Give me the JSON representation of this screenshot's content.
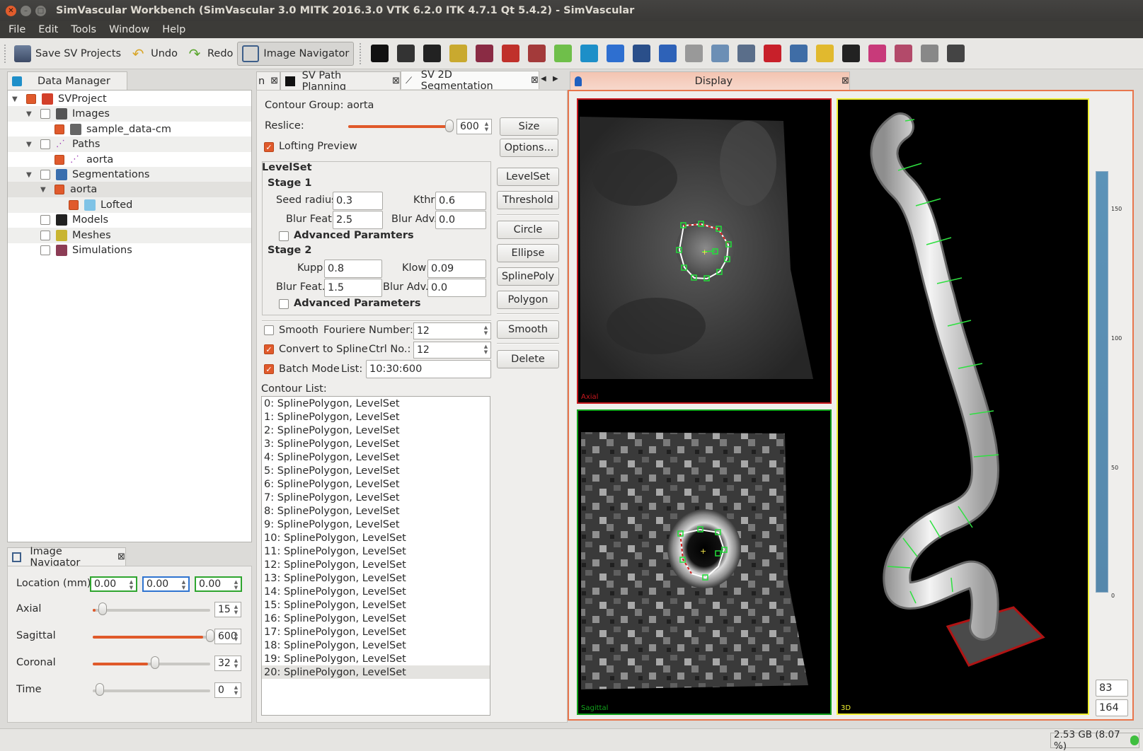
{
  "window": {
    "title": "SimVascular Workbench (SimVascular 3.0 MITK 2016.3.0 VTK 6.2.0 ITK 4.7.1 Qt 5.4.2) - SimVascular"
  },
  "menu": [
    "File",
    "Edit",
    "Tools",
    "Window",
    "Help"
  ],
  "toolbar": {
    "save_label": "Save SV Projects",
    "undo_label": "Undo",
    "redo_label": "Redo",
    "navigator_label": "Image Navigator",
    "tool_icons": [
      "image-icon",
      "path-icon",
      "segmentation-icon",
      "mesh-icon",
      "simulation-icon",
      "dicom-icon",
      "measure-icon",
      "surface-icon",
      "model-icon",
      "help-icon",
      "info-icon",
      "zoom-icon",
      "grid-icon",
      "axis-icon",
      "screenshot-icon",
      "pin-icon",
      "search-icon",
      "python-icon",
      "camera-icon",
      "network-icon",
      "molecule-icon",
      "histogram-icon",
      "eye-icon"
    ]
  },
  "data_manager": {
    "tab_title": "Data Manager",
    "tree": [
      {
        "label": "SVProject",
        "checked": true
      },
      {
        "label": "Images",
        "checked": false
      },
      {
        "label": "sample_data-cm",
        "checked": true
      },
      {
        "label": "Paths",
        "checked": false
      },
      {
        "label": "aorta",
        "checked": true
      },
      {
        "label": "Segmentations",
        "checked": false
      },
      {
        "label": "aorta",
        "checked": true
      },
      {
        "label": "Lofted",
        "checked": true
      },
      {
        "label": "Models",
        "checked": false
      },
      {
        "label": "Meshes",
        "checked": false
      },
      {
        "label": "Simulations",
        "checked": false
      }
    ]
  },
  "image_navigator": {
    "tab_title": "Image Navigator",
    "location_label": "Location (mm)",
    "location_x": "0.00",
    "location_y": "0.00",
    "location_z": "0.00",
    "axial_label": "Axial",
    "axial_value": "15",
    "axial_fraction": 0.025,
    "sagittal_label": "Sagittal",
    "sagittal_value": "600",
    "sagittal_fraction": 1.0,
    "coronal_label": "Coronal",
    "coronal_value": "32",
    "coronal_fraction": 0.5,
    "time_label": "Time",
    "time_value": "0",
    "time_fraction": 0.0
  },
  "segmentation": {
    "tabs": [
      "n",
      "SV Path Planning",
      "SV 2D Segmentation"
    ],
    "contour_group": "Contour Group: aorta",
    "reslice_label": "Reslice:",
    "reslice_value": "600",
    "reslice_fraction": 1.0,
    "size_btn": "Size",
    "lofting_preview": "Lofting Preview",
    "options_btn": "Options...",
    "levelset_title": "LevelSet",
    "stage1": "Stage 1",
    "seed_radius_label": "Seed radius",
    "seed_radius": "0.3",
    "kthr_label": "Kthr",
    "kthr": "0.6",
    "blur_feat_label": "Blur Feat.",
    "blur_feat_1": "2.5",
    "blur_adv_label": "Blur Adv.",
    "blur_adv_1": "0.0",
    "advanced_1": "Advanced  Paramters",
    "stage2": "Stage 2",
    "kupp_label": "Kupp",
    "kupp": "0.8",
    "klow_label": "Klow",
    "klow": "0.09",
    "blur_feat_2": "1.5",
    "blur_adv_2": "0.0",
    "advanced_2": "Advanced Parameters",
    "buttons": {
      "levelset": "LevelSet",
      "threshold": "Threshold",
      "circle": "Circle",
      "ellipse": "Ellipse",
      "splinepoly": "SplinePoly",
      "polygon": "Polygon",
      "smooth": "Smooth",
      "delete": "Delete"
    },
    "smooth_label": "Smooth",
    "fourier_label": "Fouriere Number:",
    "fourier_value": "12",
    "convert_label": "Convert to Spline",
    "ctrl_label": "Ctrl No.:",
    "ctrl_value": "12",
    "batch_label": "Batch Mode",
    "list_label": "List:",
    "list_value": "10:30:600",
    "contour_list_label": "Contour List:",
    "contours": [
      "0: SplinePolygon, LevelSet",
      "1: SplinePolygon, LevelSet",
      "2: SplinePolygon, LevelSet",
      "3: SplinePolygon, LevelSet",
      "4: SplinePolygon, LevelSet",
      "5: SplinePolygon, LevelSet",
      "6: SplinePolygon, LevelSet",
      "7: SplinePolygon, LevelSet",
      "8: SplinePolygon, LevelSet",
      "9: SplinePolygon, LevelSet",
      "10: SplinePolygon, LevelSet",
      "11: SplinePolygon, LevelSet",
      "12: SplinePolygon, LevelSet",
      "13: SplinePolygon, LevelSet",
      "14: SplinePolygon, LevelSet",
      "15: SplinePolygon, LevelSet",
      "16: SplinePolygon, LevelSet",
      "17: SplinePolygon, LevelSet",
      "18: SplinePolygon, LevelSet",
      "19: SplinePolygon, LevelSet",
      "20: SplinePolygon, LevelSet"
    ],
    "selected_index": 20
  },
  "display": {
    "title": "Display",
    "axial_label": "Axial",
    "sagittal_label": "Sagittal",
    "view3d_label": "3D",
    "colorbar_ticks": [
      "150",
      "100",
      "50",
      "0"
    ],
    "level_value": "83",
    "window_value": "164"
  },
  "status": {
    "memory": "2.53 GB (8.07 %)"
  },
  "colors": {
    "accent": "#e0592a",
    "axial_border": "#c8181f",
    "sagittal_border": "#11a21b",
    "view3d_border": "#f0f030",
    "contour": "#2ee040"
  }
}
